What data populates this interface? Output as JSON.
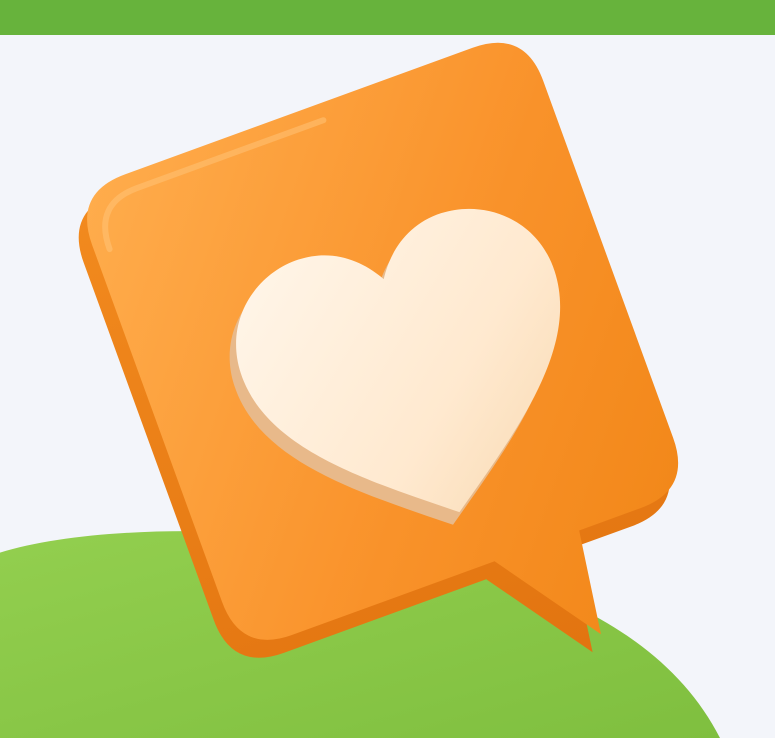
{
  "colors": {
    "top_bar": "#67b33c",
    "background": "#f3f5fa",
    "green_blob": "#8cc94a",
    "green_blob_shadow": "#78b93b",
    "bubble_main": "#f9922a",
    "bubble_light": "#ffad4d",
    "bubble_dark": "#e27410",
    "heart_light": "#fff0dc",
    "heart_shadow": "#f0c99a"
  },
  "icons": {
    "bubble": "speech-bubble-icon",
    "heart": "heart-icon"
  }
}
